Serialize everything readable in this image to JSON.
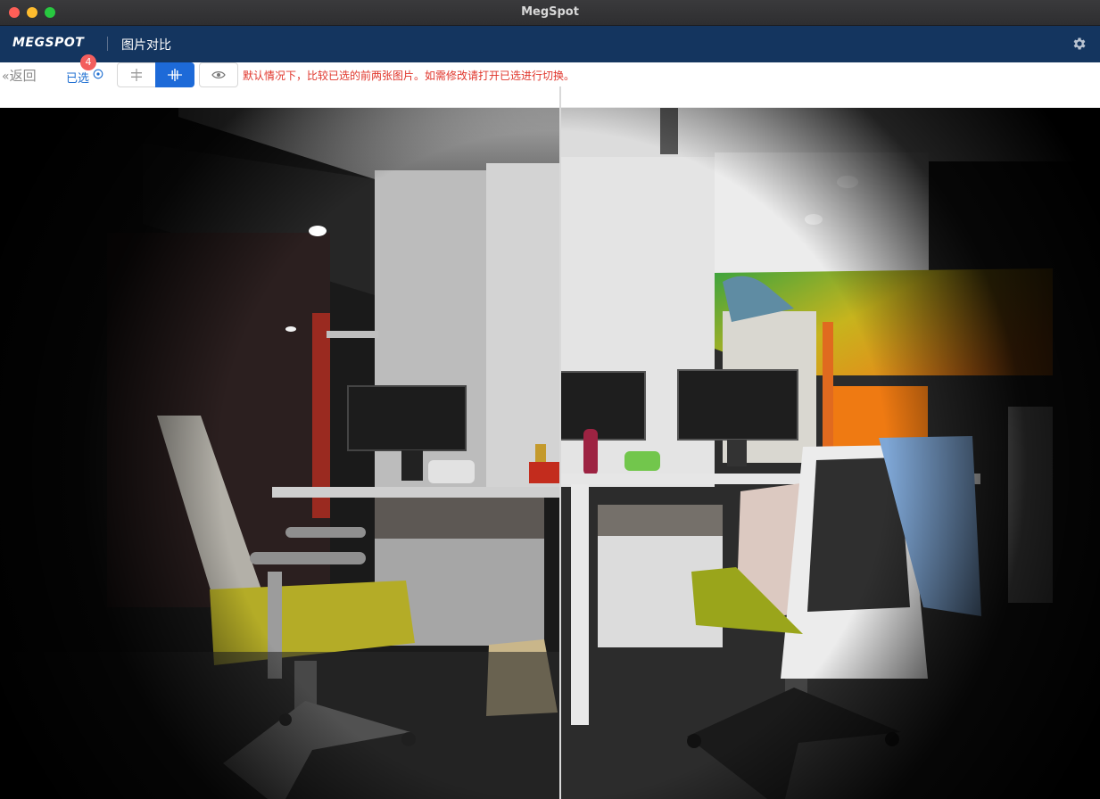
{
  "window": {
    "title": "MegSpot"
  },
  "header": {
    "logo": "MEGSPOT",
    "title": "图片对比"
  },
  "toolbar": {
    "back_label": "返回",
    "selected_label": "已选",
    "selected_count": "4",
    "hint": "默认情况下，比较已选的前两张图片。如需修改请打开已选进行切换。"
  },
  "colors": {
    "header_bg": "#14355f",
    "accent": "#1d6ad8",
    "hint_red": "#e0352b",
    "badge_red": "#f35e5e"
  },
  "icons": [
    "gear-icon",
    "double-chevron-left-icon",
    "circle-dot-icon",
    "split-horizontal-icon",
    "split-vertical-icon",
    "eye-icon"
  ]
}
